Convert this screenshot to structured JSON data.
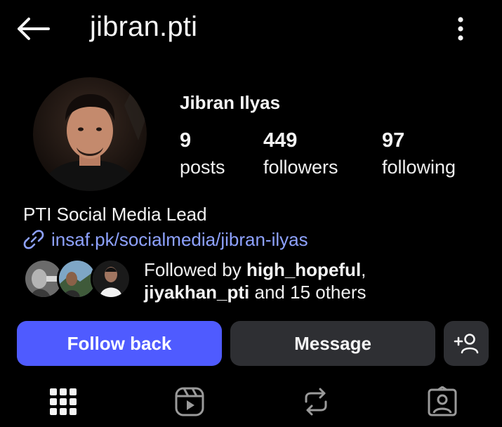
{
  "header": {
    "username": "jibran.pti",
    "back_icon": "arrow-left-icon",
    "more_icon": "more-vertical-icon"
  },
  "profile": {
    "display_name": "Jibran Ilyas",
    "stats": {
      "posts": {
        "value": "9",
        "label": "posts"
      },
      "followers": {
        "value": "449",
        "label": "followers"
      },
      "following": {
        "value": "97",
        "label": "following"
      }
    },
    "bio": "PTI Social Media Lead",
    "link": "insaf.pk/socialmedia/jibran-ilyas"
  },
  "followed_by": {
    "prefix": "Followed by ",
    "user1": "high_hopeful",
    "comma": ",",
    "user2": "jiyakhan_pti",
    "suffix": " and 15 others"
  },
  "actions": {
    "follow_back": "Follow back",
    "message": "Message",
    "add_user_icon": "add-person-icon"
  },
  "tabs": [
    {
      "icon": "grid-icon"
    },
    {
      "icon": "reels-icon"
    },
    {
      "icon": "reposts-icon"
    },
    {
      "icon": "tagged-icon"
    }
  ],
  "colors": {
    "background": "#000000",
    "primary_button": "#4f5bff",
    "secondary_button": "#2e2f33",
    "link": "#8ea2ff"
  }
}
